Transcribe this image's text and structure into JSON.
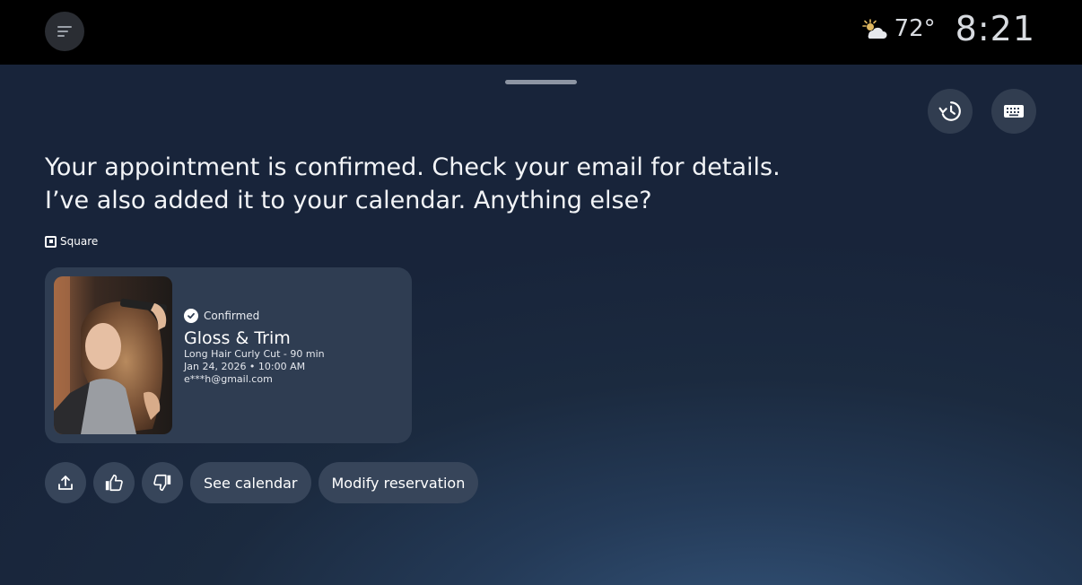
{
  "topbar": {
    "weather_icon": "partly-cloudy-icon",
    "temperature": "72°",
    "time": "8:21"
  },
  "message": {
    "line1": "Your appointment is confirmed. Check your email for details.",
    "line2": "I’ve also added it to your calendar. Anything else?"
  },
  "provider": {
    "name": "Square"
  },
  "card": {
    "status": "Confirmed",
    "title": "Gloss & Trim",
    "service": "Long Hair Curly Cut - 90 min",
    "datetime": "Jan 24, 2026 • 10:00 AM",
    "email": "e***h@gmail.com"
  },
  "actions": {
    "icons": [
      "share-icon",
      "thumbs-up-icon",
      "thumbs-down-icon"
    ],
    "see_calendar": "See calendar",
    "modify": "Modify reservation"
  },
  "colors": {
    "background": "#1b2a3f",
    "card": "#2f3d52",
    "button": "#37455a"
  }
}
